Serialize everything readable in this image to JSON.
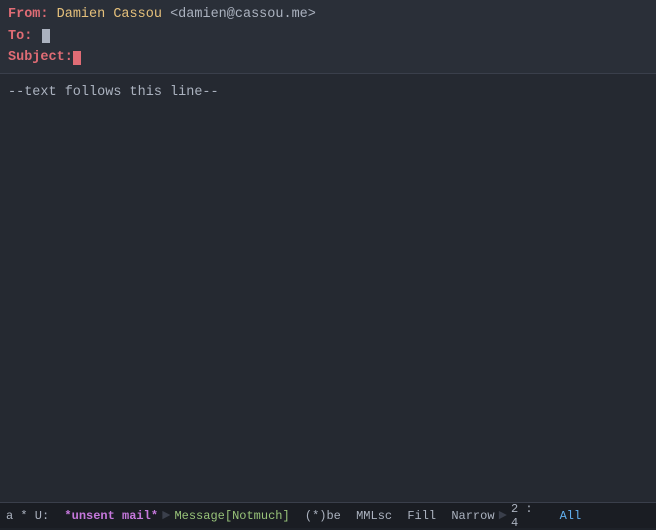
{
  "header": {
    "from_label": "From:",
    "from_name": "Damien Cassou",
    "from_email": "<damien@cassou.me>",
    "to_label": "To:",
    "subject_label": "Subject:"
  },
  "body": {
    "line1": "--text follows this line--"
  },
  "statusbar": {
    "prefix": "a * U:",
    "unsent": "*unsent mail*",
    "mode": "Message[Notmuch]",
    "buffer_flags": "(*)be",
    "abbrev": "MMLsc",
    "fill": "Fill",
    "narrow": "Narrow",
    "position": "2 : 4",
    "all": "All"
  }
}
